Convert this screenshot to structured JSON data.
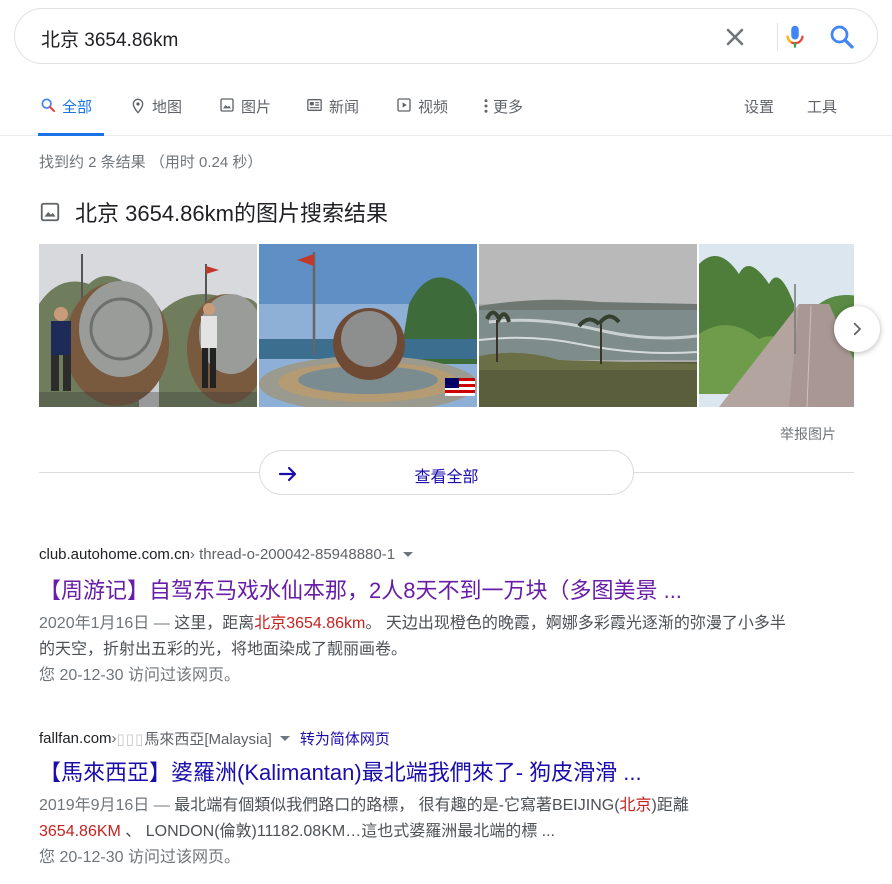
{
  "search": {
    "query": "北京 3654.86km",
    "icons": [
      "close-icon",
      "mic-icon",
      "search-icon"
    ]
  },
  "tabs": [
    {
      "label": "全部",
      "icon": "search-icon",
      "active": true
    },
    {
      "label": "地图",
      "icon": "map-pin-icon"
    },
    {
      "label": "图片",
      "icon": "image-icon"
    },
    {
      "label": "新闻",
      "icon": "news-icon"
    },
    {
      "label": "视频",
      "icon": "play-icon"
    },
    {
      "label": "更多",
      "icon": "more-vert-icon"
    }
  ],
  "tools": {
    "settings": "设置",
    "tools": "工具"
  },
  "stats": "找到约 2 条结果 （用时 0.24 秒）",
  "image_results": {
    "title": "北京 3654.86km的图片搜索结果",
    "report": "举报图片",
    "view_all": "查看全部"
  },
  "results": [
    {
      "domain": "club.autohome.com.cn",
      "path": " › thread-o-200042-85948880-1",
      "title": "【周游记】自驾东马戏水仙本那，2人8天不到一万块（多图美景 ...",
      "date": "2020年1月16日 — ",
      "snippet_a": "这里，距离",
      "snippet_hl": "北京3654.86km",
      "snippet_b": "。 天边出现橙色的晚霞，婀娜多彩霞光逐渐的弥漫了小多半的天空，折射出五彩的光，将地面染成了靓丽画卷。",
      "visited": "您 20-12-30 访问过该网页。"
    },
    {
      "domain": "fallfan.com",
      "path_prefix": " › ",
      "path_blur": "▯▯▯",
      "path": "馬來西亞[Malaysia]",
      "translate": "转为简体网页",
      "title": "【馬來西亞】婆羅洲(Kalimantan)最北端我們來了- 狗皮滑滑 ...",
      "date": "2019年9月16日 — ",
      "snippet_a": "最北端有個類似我們路口的路標， 很有趣的是-它寫著BEIJING(",
      "snippet_hl1": "北京",
      "snippet_b": ")距離",
      "snippet_hl2": "3654.86KM",
      "snippet_c": " 、 LONDON(倫敦)11182.08KM…這也式婆羅洲最北端的標 ...",
      "visited": "您 20-12-30 访问过该网页。"
    }
  ]
}
